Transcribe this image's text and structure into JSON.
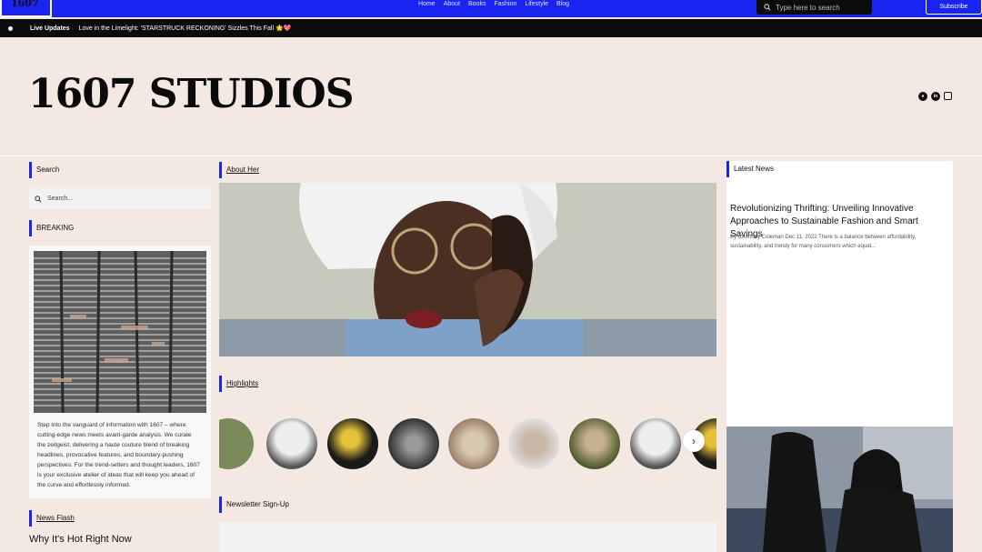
{
  "nav": {
    "logo": "1607",
    "links": [
      "Home",
      "About",
      "Books",
      "Fashion",
      "Lifestyle",
      "Blog"
    ],
    "search_placeholder": "Type here to search",
    "subscribe": "Subscribe"
  },
  "live": {
    "label": "Live Updates",
    "headline": "Love in the Limelight: 'STARSTRUCK RECKONING' Sizzles This Fall 🌟💖"
  },
  "header": {
    "brand": "1607 STUDIOS",
    "socials": [
      "bluesky-icon",
      "linkedin-icon",
      "instagram-icon"
    ]
  },
  "left": {
    "search_heading": "Search",
    "search_placeholder": "Search...",
    "breaking_heading": "BREAKING",
    "breaking_text": "Step into the vanguard of information with 1607 – where cutting-edge news meets avant-garde analysis. We curate the zeitgeist, delivering a haute couture blend of breaking headlines, provocative features, and boundary-pushing perspectives. For the trend-setters and thought leaders, 1607 is your exclusive atelier of ideas that will keep you ahead of the curve and effortlessly informed.",
    "newsflash_heading": "News Flash",
    "newsflash_title": "Why It's Hot Right Now"
  },
  "middle": {
    "about_heading": "About Her",
    "highlights_heading": "Highlights",
    "newsletter_heading": "Newsletter Sign-Up"
  },
  "right": {
    "latest_heading": "Latest News",
    "article_title": "Revolutionizing Thrifting: Unveiling Innovative Approaches to Sustainable Fashion and Smart Savings",
    "article_meta": "By Courtney Coleman Dec 11, 2022 There is a balance between affordability, sustainability, and trendy for many consumers which equat..."
  },
  "colors": {
    "accent": "#1a24f0",
    "background": "#f3e8e2",
    "bar": "#0c0c0c"
  }
}
